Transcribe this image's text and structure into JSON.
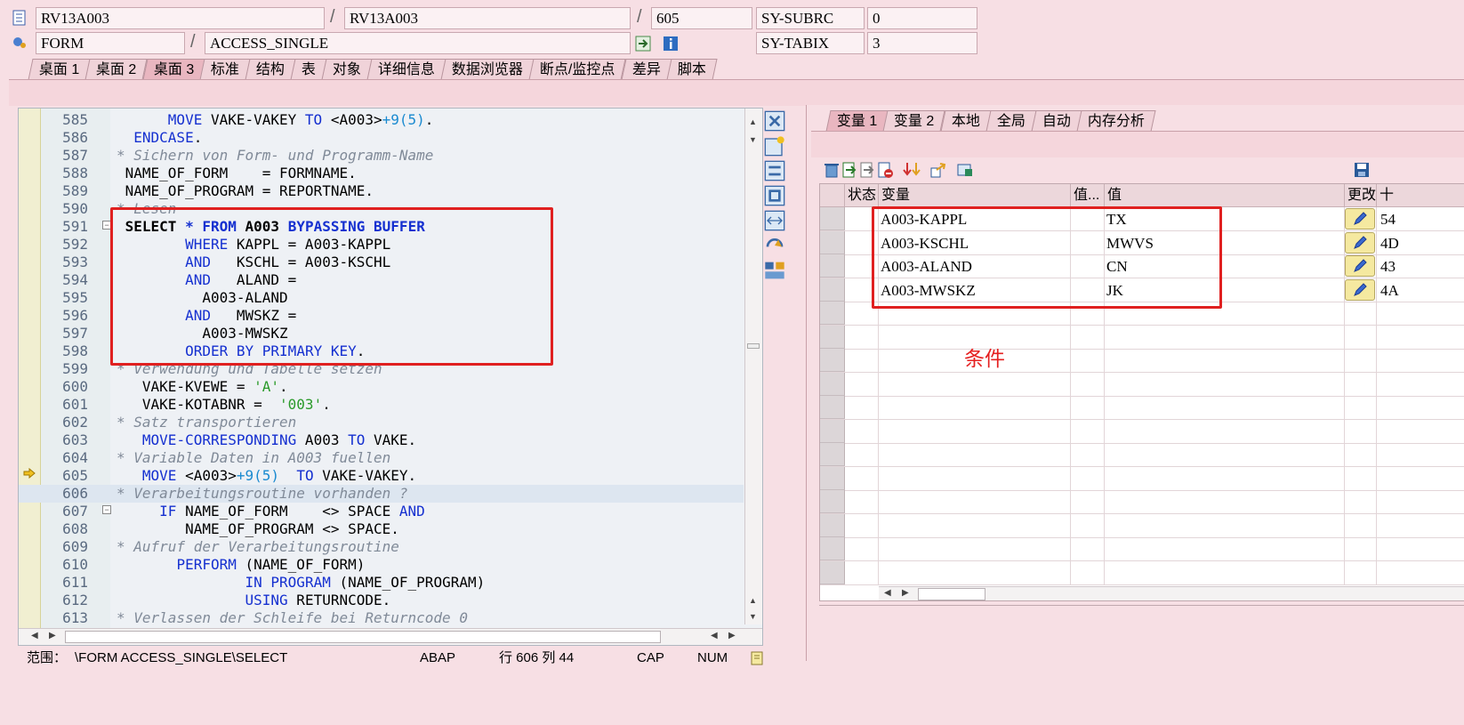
{
  "header": {
    "row1": {
      "program1": "RV13A003",
      "program2": "RV13A003",
      "line": "605",
      "sysvar_name": "SY-SUBRC",
      "sysvar_value": "0"
    },
    "row2": {
      "event_type": "FORM",
      "event_name": "ACCESS_SINGLE",
      "sysvar_name": "SY-TABIX",
      "sysvar_value": "3"
    }
  },
  "main_tabs": [
    "桌面 1",
    "桌面 2",
    "桌面 3",
    "标准",
    "结构",
    "表",
    "对象",
    "详细信息",
    "数据浏览器",
    "断点/监控点",
    "差异",
    "脚本"
  ],
  "active_tab_index": 2,
  "code": {
    "lines": [
      {
        "n": "585",
        "t": "      MOVE VAKE-VAKEY TO <A003>+9(5)."
      },
      {
        "n": "586",
        "t": "  ENDCASE."
      },
      {
        "n": "587",
        "t": "* Sichern von Form- und Programm-Name"
      },
      {
        "n": "588",
        "t": " NAME_OF_FORM    = FORMNAME."
      },
      {
        "n": "589",
        "t": " NAME_OF_PROGRAM = REPORTNAME."
      },
      {
        "n": "590",
        "t": "* Lesen"
      },
      {
        "n": "591",
        "t": " SELECT * FROM A003 BYPASSING BUFFER"
      },
      {
        "n": "592",
        "t": "        WHERE KAPPL = A003-KAPPL"
      },
      {
        "n": "593",
        "t": "        AND   KSCHL = A003-KSCHL"
      },
      {
        "n": "594",
        "t": "        AND   ALAND ="
      },
      {
        "n": "595",
        "t": "          A003-ALAND"
      },
      {
        "n": "596",
        "t": "        AND   MWSKZ ="
      },
      {
        "n": "597",
        "t": "          A003-MWSKZ"
      },
      {
        "n": "598",
        "t": "        ORDER BY PRIMARY KEY."
      },
      {
        "n": "599",
        "t": "* Verwendung und Tabelle setzen"
      },
      {
        "n": "600",
        "t": "   VAKE-KVEWE = 'A'."
      },
      {
        "n": "601",
        "t": "   VAKE-KOTABNR =  '003'."
      },
      {
        "n": "602",
        "t": "* Satz transportieren"
      },
      {
        "n": "603",
        "t": "   MOVE-CORRESPONDING A003 TO VAKE."
      },
      {
        "n": "604",
        "t": "* Variable Daten in A003 fuellen"
      },
      {
        "n": "605",
        "t": "   MOVE <A003>+9(5)  TO VAKE-VAKEY."
      },
      {
        "n": "606",
        "t": "* Verarbeitungsroutine vorhanden ?"
      },
      {
        "n": "607",
        "t": "     IF NAME_OF_FORM    <> SPACE AND"
      },
      {
        "n": "608",
        "t": "        NAME_OF_PROGRAM <> SPACE."
      },
      {
        "n": "609",
        "t": "* Aufruf der Verarbeitungsroutine"
      },
      {
        "n": "610",
        "t": "       PERFORM (NAME_OF_FORM)"
      },
      {
        "n": "611",
        "t": "               IN PROGRAM (NAME_OF_PROGRAM)"
      },
      {
        "n": "612",
        "t": "               USING RETURNCODE."
      },
      {
        "n": "613",
        "t": "* Verlassen der Schleife bei Returncode 0"
      }
    ]
  },
  "status_bar": {
    "scope_label": "范围：",
    "scope_value": "\\FORM ACCESS_SINGLE\\SELECT",
    "language": "ABAP",
    "position": "行 606 列  44",
    "caps": "CAP",
    "num": "NUM"
  },
  "var_tabs": [
    "变量 1",
    "变量 2",
    "本地",
    "全局",
    "自动",
    "内存分析"
  ],
  "active_var_tab_index": 0,
  "grid": {
    "headers": {
      "status": "状态",
      "variable": "变量",
      "value_short": "值...",
      "value": "值",
      "change": "更改",
      "hex": "十"
    },
    "rows": [
      {
        "variable": "A003-KAPPL",
        "value": "TX",
        "hex": "54"
      },
      {
        "variable": "A003-KSCHL",
        "value": "MWVS",
        "hex": "4D"
      },
      {
        "variable": "A003-ALAND",
        "value": "CN",
        "hex": "43"
      },
      {
        "variable": "A003-MWSKZ",
        "value": "JK",
        "hex": "4A"
      }
    ],
    "empty_rows": 12
  },
  "annotation": "条件",
  "colors": {
    "keyword": "#1530d0",
    "comment": "#808a98",
    "string": "#2a9a2a",
    "highlight_box": "#e02020"
  }
}
